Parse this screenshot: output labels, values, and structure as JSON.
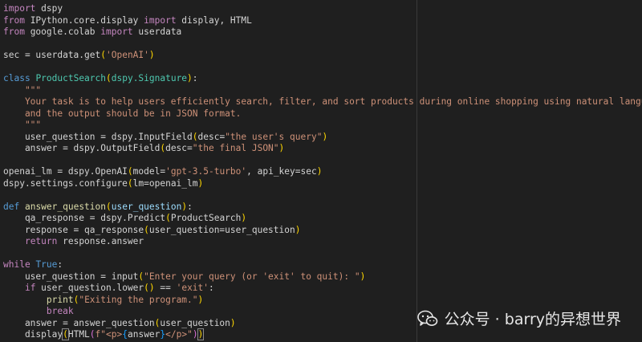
{
  "editor": {
    "lines": [
      [
        {
          "t": "import",
          "c": "kw"
        },
        {
          "t": " dspy",
          "c": "df"
        }
      ],
      [
        {
          "t": "from",
          "c": "kw"
        },
        {
          "t": " IPython.core.display ",
          "c": "df"
        },
        {
          "t": "import",
          "c": "kw"
        },
        {
          "t": " display, HTML",
          "c": "df"
        }
      ],
      [
        {
          "t": "from",
          "c": "kw"
        },
        {
          "t": " google.colab ",
          "c": "df"
        },
        {
          "t": "import",
          "c": "kw"
        },
        {
          "t": " userdata",
          "c": "df"
        }
      ],
      [],
      [
        {
          "t": "sec = userdata.get",
          "c": "df"
        },
        {
          "t": "(",
          "c": "b1"
        },
        {
          "t": "'OpenAI'",
          "c": "st"
        },
        {
          "t": ")",
          "c": "b1"
        }
      ],
      [],
      [
        {
          "t": "class",
          "c": "de"
        },
        {
          "t": " ",
          "c": "df"
        },
        {
          "t": "ProductSearch",
          "c": "cl"
        },
        {
          "t": "(",
          "c": "b1"
        },
        {
          "t": "dspy.Signature",
          "c": "cl"
        },
        {
          "t": ")",
          "c": "b1"
        },
        {
          "t": ":",
          "c": "df"
        }
      ],
      [
        {
          "t": "    \"\"\"",
          "c": "st"
        }
      ],
      [
        {
          "t": "    Your task is to help users efficiently search, filter, and sort products during online shopping using natural language,",
          "c": "st"
        }
      ],
      [
        {
          "t": "    and the output should be in JSON format.",
          "c": "st"
        }
      ],
      [
        {
          "t": "    \"\"\"",
          "c": "st"
        }
      ],
      [
        {
          "t": "    user_question = dspy.InputField",
          "c": "df"
        },
        {
          "t": "(",
          "c": "b1"
        },
        {
          "t": "desc=",
          "c": "df"
        },
        {
          "t": "\"the user's query\"",
          "c": "st"
        },
        {
          "t": ")",
          "c": "b1"
        }
      ],
      [
        {
          "t": "    answer = dspy.OutputField",
          "c": "df"
        },
        {
          "t": "(",
          "c": "b1"
        },
        {
          "t": "desc=",
          "c": "df"
        },
        {
          "t": "\"the final JSON\"",
          "c": "st"
        },
        {
          "t": ")",
          "c": "b1"
        }
      ],
      [],
      [
        {
          "t": "openai_lm = dspy.OpenAI",
          "c": "df"
        },
        {
          "t": "(",
          "c": "b1"
        },
        {
          "t": "model=",
          "c": "df"
        },
        {
          "t": "'gpt-3.5-turbo'",
          "c": "st"
        },
        {
          "t": ", api_key=sec",
          "c": "df"
        },
        {
          "t": ")",
          "c": "b1"
        }
      ],
      [
        {
          "t": "dspy.settings.configure",
          "c": "df"
        },
        {
          "t": "(",
          "c": "b1"
        },
        {
          "t": "lm=openai_lm",
          "c": "df"
        },
        {
          "t": ")",
          "c": "b1"
        }
      ],
      [],
      [
        {
          "t": "def",
          "c": "de"
        },
        {
          "t": " ",
          "c": "df"
        },
        {
          "t": "answer_question",
          "c": "fn"
        },
        {
          "t": "(",
          "c": "b1"
        },
        {
          "t": "user_question",
          "c": "va"
        },
        {
          "t": ")",
          "c": "b1"
        },
        {
          "t": ":",
          "c": "df"
        }
      ],
      [
        {
          "t": "    qa_response = dspy.Predict",
          "c": "df"
        },
        {
          "t": "(",
          "c": "b1"
        },
        {
          "t": "ProductSearch",
          "c": "df"
        },
        {
          "t": ")",
          "c": "b1"
        }
      ],
      [
        {
          "t": "    response = qa_response",
          "c": "df"
        },
        {
          "t": "(",
          "c": "b1"
        },
        {
          "t": "user_question=user_question",
          "c": "df"
        },
        {
          "t": ")",
          "c": "b1"
        }
      ],
      [
        {
          "t": "    ",
          "c": "df"
        },
        {
          "t": "return",
          "c": "kw"
        },
        {
          "t": " response.answer",
          "c": "df"
        }
      ],
      [],
      [
        {
          "t": "while",
          "c": "kw"
        },
        {
          "t": " ",
          "c": "df"
        },
        {
          "t": "True",
          "c": "de"
        },
        {
          "t": ":",
          "c": "df"
        }
      ],
      [
        {
          "t": "    user_question = input",
          "c": "df"
        },
        {
          "t": "(",
          "c": "b1"
        },
        {
          "t": "\"Enter your query (or 'exit' to quit): \"",
          "c": "st"
        },
        {
          "t": ")",
          "c": "b1"
        }
      ],
      [
        {
          "t": "    ",
          "c": "df"
        },
        {
          "t": "if",
          "c": "kw"
        },
        {
          "t": " user_question.lower",
          "c": "df"
        },
        {
          "t": "()",
          "c": "b1"
        },
        {
          "t": " == ",
          "c": "df"
        },
        {
          "t": "'exit'",
          "c": "st"
        },
        {
          "t": ":",
          "c": "df"
        }
      ],
      [
        {
          "t": "        ",
          "c": "df"
        },
        {
          "t": "print",
          "c": "fn"
        },
        {
          "t": "(",
          "c": "b1"
        },
        {
          "t": "\"Exiting the program.\"",
          "c": "st"
        },
        {
          "t": ")",
          "c": "b1"
        }
      ],
      [
        {
          "t": "        ",
          "c": "df"
        },
        {
          "t": "break",
          "c": "kw"
        }
      ],
      [
        {
          "t": "    answer = answer_question",
          "c": "df"
        },
        {
          "t": "(",
          "c": "b1"
        },
        {
          "t": "user_question",
          "c": "df"
        },
        {
          "t": ")",
          "c": "b1"
        }
      ],
      [
        {
          "t": "    display",
          "c": "df"
        },
        {
          "t": "(",
          "c": "b1 bm"
        },
        {
          "t": "HTML",
          "c": "df"
        },
        {
          "t": "(",
          "c": "b2"
        },
        {
          "t": "f\"<p>",
          "c": "st"
        },
        {
          "t": "{",
          "c": "b3"
        },
        {
          "t": "answer",
          "c": "df"
        },
        {
          "t": "}",
          "c": "b3"
        },
        {
          "t": "</p>\"",
          "c": "st"
        },
        {
          "t": ")",
          "c": "b2"
        },
        {
          "t": ")",
          "c": "b1 bm"
        }
      ]
    ]
  },
  "watermark": {
    "text": "公众号 · barry的异想世界",
    "icon": "wechat-icon"
  }
}
